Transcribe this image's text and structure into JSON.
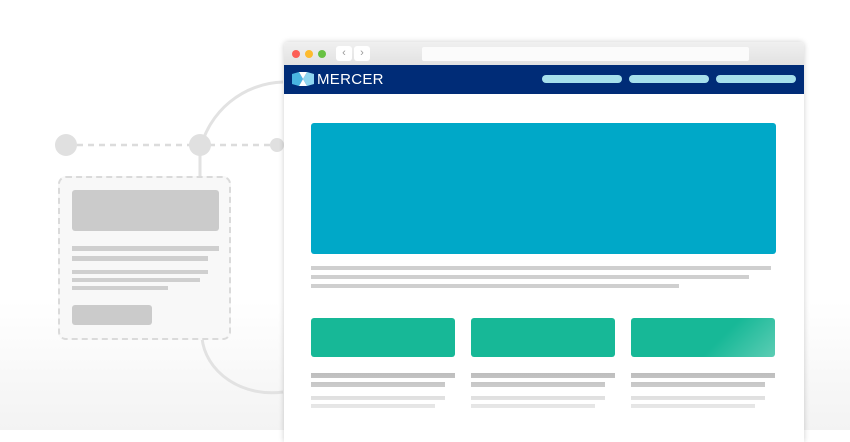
{
  "brand": {
    "name": "MERCER",
    "logo_icon": "mercer-logo-icon"
  },
  "browser": {
    "back_icon": "chevron-left-icon",
    "forward_icon": "chevron-right-icon",
    "address": ""
  },
  "colors": {
    "header": "#002c77",
    "hero": "#00a8c8",
    "cards": "#17b897",
    "nav_pills": "#a6e0ec"
  }
}
